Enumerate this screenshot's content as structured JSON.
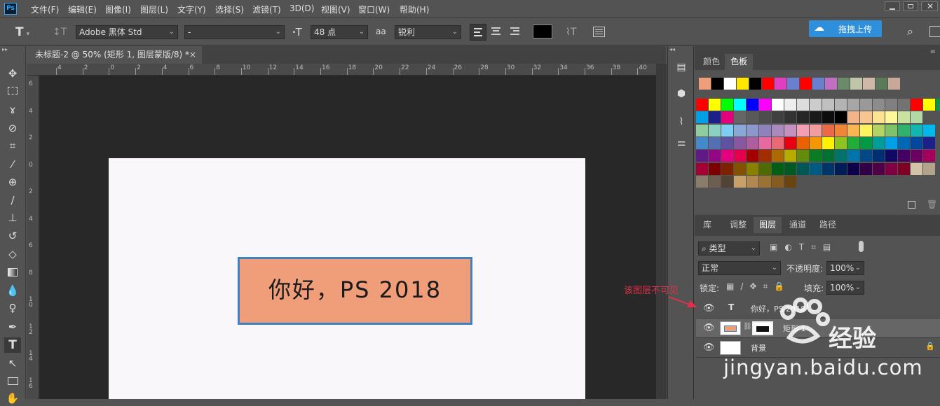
{
  "app": {
    "logo": "Ps"
  },
  "menu": [
    "文件(F)",
    "编辑(E)",
    "图像(I)",
    "图层(L)",
    "文字(Y)",
    "选择(S)",
    "滤镜(T)",
    "3D(D)",
    "视图(V)",
    "窗口(W)",
    "帮助(H)"
  ],
  "options": {
    "font_family": "Adobe 黑体 Std",
    "font_style": "-",
    "font_size": "48 点",
    "aa_label": "aa",
    "antialias": "锐利",
    "text_color": "#000000",
    "upload_label": "拖拽上传"
  },
  "document": {
    "tab_title": "未标题-2 @ 50% (矩形 1, 图层蒙版/8) *",
    "close_glyph": "×",
    "canvas_text": "你好，PS 2018",
    "rect_fill": "#f09e7a",
    "rect_stroke": "#3f81c5"
  },
  "rulers": {
    "top": [
      "4",
      "2",
      "0",
      "2",
      "4",
      "6",
      "8",
      "10",
      "12",
      "14",
      "16",
      "18",
      "20",
      "22",
      "24",
      "26",
      "28",
      "30",
      "32",
      "34",
      "36",
      "38",
      "40"
    ],
    "left": [
      "6",
      "4",
      "2",
      "0",
      "2",
      "4",
      "6",
      "8",
      "1 0",
      "1 2",
      "1 4",
      "1 6"
    ]
  },
  "color_panel": {
    "tabs": [
      "颜色",
      "色板"
    ],
    "active_tab": "色板",
    "recent_swatches": [
      "#f09e7a",
      "#000000",
      "#ffffff",
      "#ffe600",
      "#000000",
      "#ff0000",
      "#e040c0",
      "#6a7fd0",
      "#ff0000",
      "#6a7fd0",
      "#c070c0",
      "#6a8a6a",
      "#c0c4a8",
      "#d0b8a8",
      "#5a7a5a",
      "#c8a898"
    ],
    "swatch_rows": [
      [
        "#ff0000",
        "#ffff00",
        "#00ff00",
        "#00ffff",
        "#0000ff",
        "#ff00ff",
        "#ffffff",
        "#eeeeee",
        "#dddddd",
        "#cccccc",
        "#c0c0c0",
        "#b3b3b3",
        "#a6a6a6",
        "#999999",
        "#8c8c8c",
        "#808080",
        "#737373",
        "#ff0000",
        "#ffff00",
        "#009944"
      ],
      [
        "#00a0e9",
        "#1d2088",
        "#e4007f",
        "#666666",
        "#595959",
        "#4d4d4d",
        "#404040",
        "#333333",
        "#262626",
        "#1a1a1a",
        "#0d0d0d",
        "#000000",
        "#f3b48a",
        "#f8c48f",
        "#fde38f",
        "#fff79a",
        "#c9e29e",
        "#b2d9a5"
      ],
      [
        "#8fcd9e",
        "#8ad1c4",
        "#7ecef4",
        "#89a8d8",
        "#8c97cb",
        "#8f82bc",
        "#aa89bd",
        "#c490bf",
        "#f29fb6",
        "#f19d9d",
        "#eb6947",
        "#f08437",
        "#f8b551",
        "#fff45c",
        "#b3d465",
        "#80c269",
        "#32b16c",
        "#13b5b1",
        "#00b7ee"
      ],
      [
        "#448aca",
        "#556fb5",
        "#5f52a0",
        "#8957a1",
        "#ae5da1",
        "#ea68a2",
        "#eb6877",
        "#e60012",
        "#eb6100",
        "#f39800",
        "#fff100",
        "#8fc31f",
        "#22ac38",
        "#009944",
        "#009e96",
        "#00a0e9",
        "#0068b7",
        "#00479d",
        "#1d2088"
      ],
      [
        "#601986",
        "#920783",
        "#e4007f",
        "#e5004f",
        "#a40000",
        "#a42d00",
        "#ac6a00",
        "#b7aa00",
        "#638c0b",
        "#097c25",
        "#007130",
        "#00736d",
        "#0075a9",
        "#004986",
        "#002e73",
        "#100964",
        "#440062",
        "#6a005f",
        "#a4005b"
      ],
      [
        "#a40035",
        "#7d0000",
        "#7e2100",
        "#835000",
        "#8a8000",
        "#4f6a00",
        "#005e15",
        "#005a22",
        "#005855",
        "#005a82",
        "#003567",
        "#001d58",
        "#0c004b",
        "#330047",
        "#500047",
        "#7e0043",
        "#7e0025",
        "#d5c3a8",
        "#b4a38c"
      ],
      [
        "#8a7b6a",
        "#6d5e4f",
        "#524435",
        "#c8a16a",
        "#b08850",
        "#9a7233",
        "#845d1f",
        "#6a4410"
      ]
    ]
  },
  "layers_panel": {
    "tabs": [
      "库",
      "调整",
      "图层",
      "通道",
      "路径"
    ],
    "active_tab": "图层",
    "filter_label": "类型",
    "blend_mode": "正常",
    "opacity_label": "不透明度:",
    "opacity": "100%",
    "lock_label": "锁定:",
    "fill_label": "填充:",
    "fill": "100%",
    "layers": [
      {
        "name": "你好，PS 2018",
        "kind": "text",
        "kind_glyph": "T"
      },
      {
        "name": "矩形 1",
        "kind": "shape"
      },
      {
        "name": "背景",
        "kind": "background"
      }
    ]
  },
  "annotation": {
    "text": "该图层不可见"
  },
  "watermark": {
    "brand": "经验",
    "url": "jingyan.baidu.com"
  }
}
